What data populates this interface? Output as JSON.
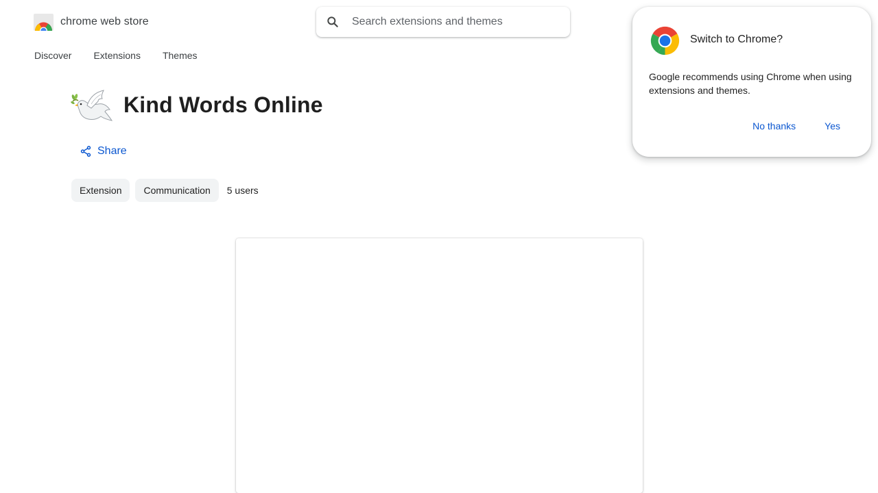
{
  "header": {
    "logo_text": "chrome web store",
    "search_placeholder": "Search extensions and themes",
    "search_icon": "search-icon"
  },
  "nav": {
    "items": [
      "Discover",
      "Extensions",
      "Themes"
    ]
  },
  "extension": {
    "title": "Kind Words Online",
    "icon": "dove-icon",
    "share_label": "Share",
    "chips": [
      "Extension",
      "Communication"
    ],
    "users": "5 users"
  },
  "popup": {
    "title": "Switch to Chrome?",
    "body": "Google recommends using Chrome when using extensions and themes.",
    "no_label": "No thanks",
    "yes_label": "Yes"
  },
  "colors": {
    "link_blue": "#0b57d0",
    "chip_bg": "#f1f3f4",
    "text": "#1f1f1f"
  }
}
